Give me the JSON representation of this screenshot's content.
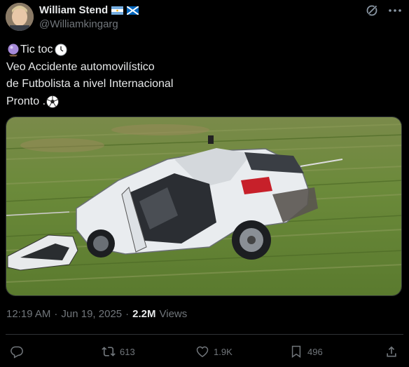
{
  "author": {
    "display_name": "William Stend",
    "handle": "@Williamkingarg",
    "flags": [
      "argentina-flag",
      "scotland-flag"
    ]
  },
  "tweet": {
    "lines": [
      {
        "prefix_icon": "crystal-ball-emoji",
        "text": "Tic toc",
        "suffix_icon": "clock-emoji"
      },
      {
        "text": "Veo Accidente automovilístico"
      },
      {
        "text": "de Futbolista a nivel Internacional"
      },
      {
        "text": "Pronto .",
        "suffix_icon": "soccer-ball-emoji"
      }
    ]
  },
  "media": {
    "description_icon": "crashed-car-photo"
  },
  "meta": {
    "time": "12:19 AM",
    "separator1": "·",
    "date": "Jun 19, 2025",
    "separator2": "·",
    "views_count": "2.2M",
    "views_label": "Views"
  },
  "actions": {
    "reply": {
      "icon": "reply-icon",
      "count": ""
    },
    "retweet": {
      "icon": "retweet-icon",
      "count": "613"
    },
    "like": {
      "icon": "heart-icon",
      "count": "1.9K"
    },
    "bookmark": {
      "icon": "bookmark-icon",
      "count": "496"
    },
    "share": {
      "icon": "share-icon",
      "count": ""
    }
  },
  "colors": {
    "background": "#000000",
    "text": "#e7e9ea",
    "muted": "#71767b",
    "border": "#2f3336"
  }
}
